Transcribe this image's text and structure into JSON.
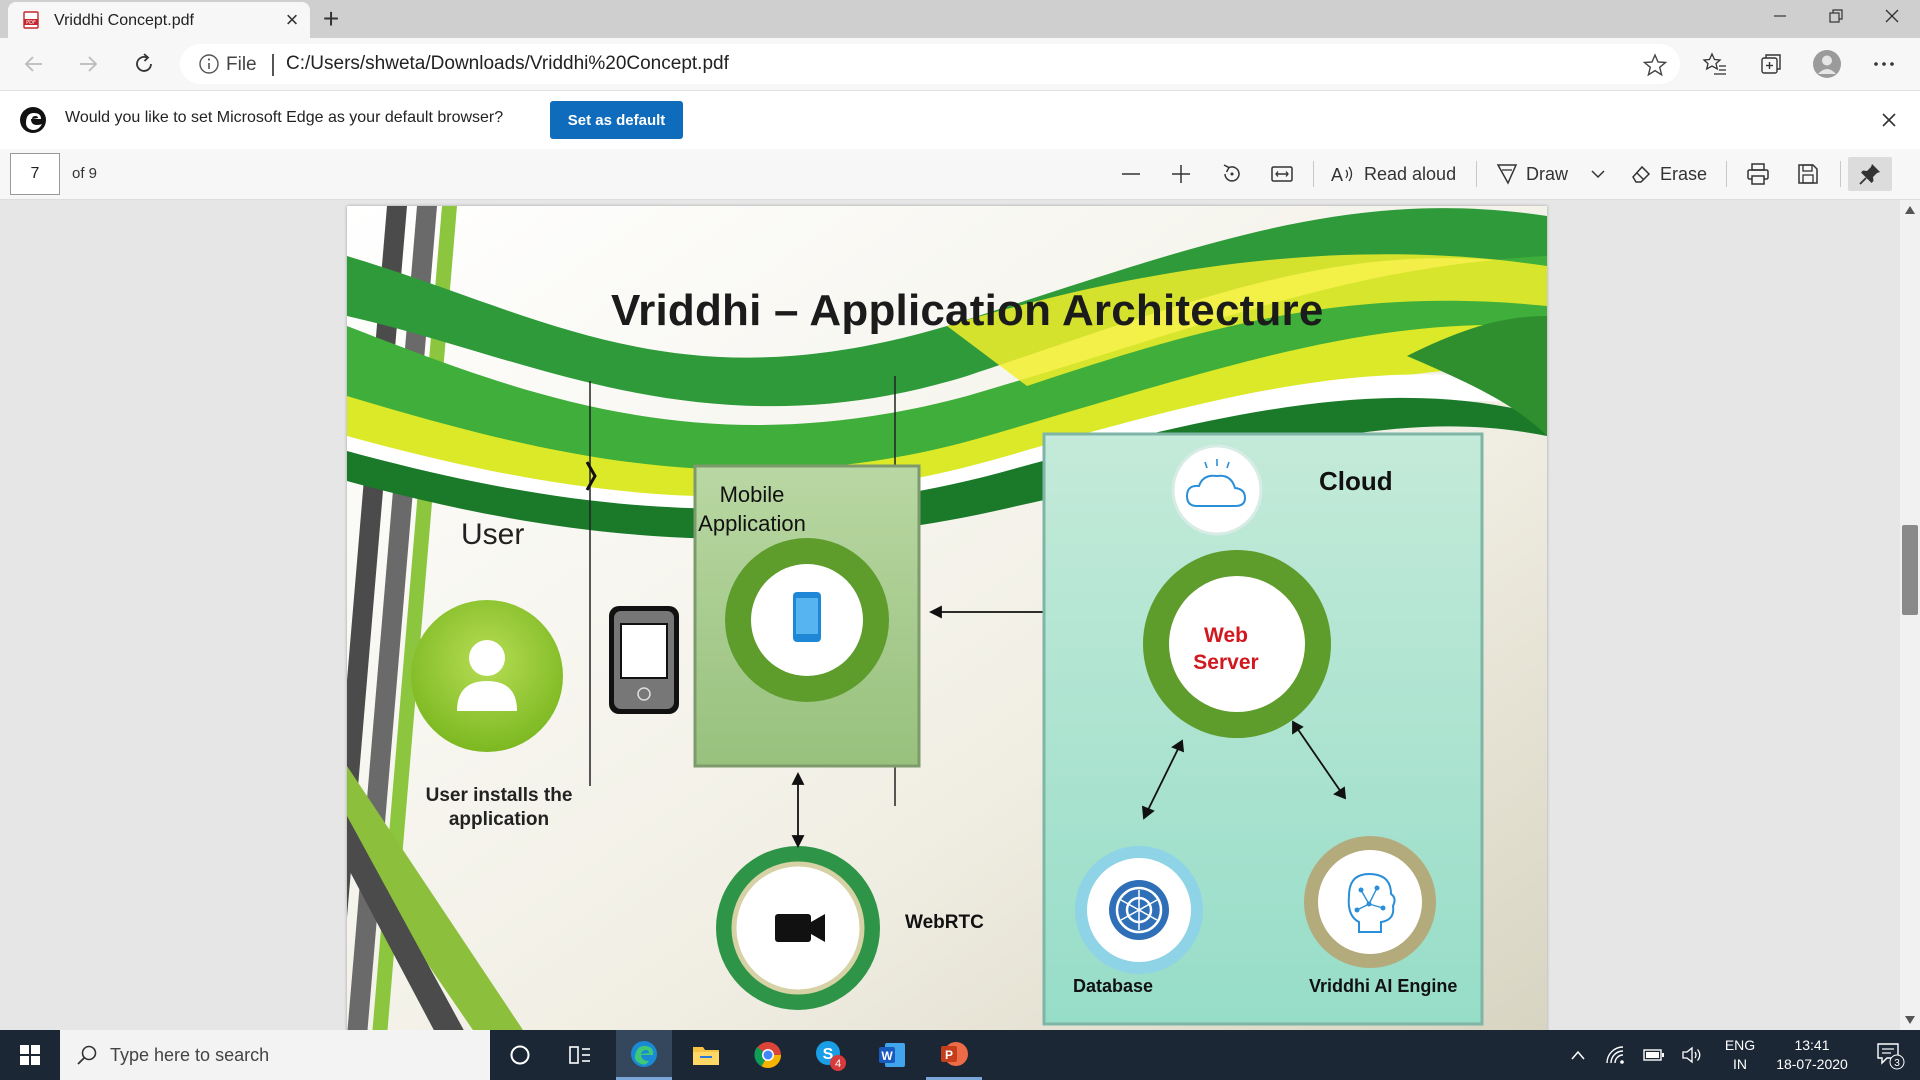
{
  "browser": {
    "tab_title": "Vriddhi Concept.pdf",
    "file_label": "File",
    "url": "C:/Users/shweta/Downloads/Vriddhi%20Concept.pdf"
  },
  "infobar": {
    "message": "Would you like to set Microsoft Edge as your default browser?",
    "button_label": "Set as default"
  },
  "pdf_toolbar": {
    "page_number": "7",
    "page_total": "of 9",
    "read_aloud_label": "Read aloud",
    "draw_label": "Draw",
    "erase_label": "Erase"
  },
  "slide": {
    "title": "Vriddhi – Application Architecture",
    "user_label": "User",
    "user_caption": "User installs the application",
    "mobile_app_label": "Mobile Application",
    "cloud_label": "Cloud",
    "web_server_label": "Web Server",
    "database_label": "Database",
    "ai_engine_label": "Vriddhi AI Engine",
    "webrtc_label": "WebRTC"
  },
  "taskbar": {
    "search_placeholder": "Type here to search",
    "lang_line1": "ENG",
    "lang_line2": "IN",
    "time": "13:41",
    "date": "18-07-2020",
    "notification_count": "3",
    "skype_badge": "4"
  },
  "colors": {
    "accent_blue": "#0f6cbd",
    "web_server_red": "#d0181e",
    "cloud_panel": "#a4e3d3",
    "green_ring": "#5e9c2c",
    "taskbar_bg": "#1b2735"
  }
}
